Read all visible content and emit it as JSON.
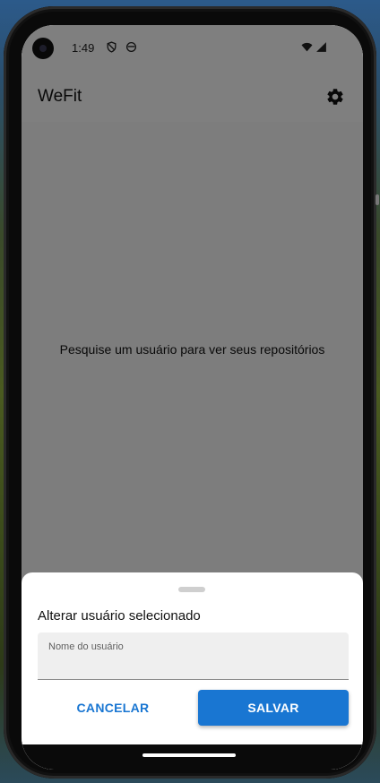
{
  "status_bar": {
    "time": "1:49",
    "icons": [
      "shield-icon",
      "face-icon",
      "wifi-icon",
      "signal-icon"
    ]
  },
  "app_bar": {
    "title": "WeFit",
    "settings_icon": "gear-icon"
  },
  "main": {
    "empty_message": "Pesquise um usuário para ver seus repositórios"
  },
  "bottom_sheet": {
    "title": "Alterar usuário selecionado",
    "username_field": {
      "label": "Nome do usuário",
      "value": "",
      "placeholder": ""
    },
    "cancel_label": "CANCELAR",
    "save_label": "SALVAR"
  },
  "colors": {
    "accent": "#1976d2",
    "scrim": "rgba(0,0,0,0.5)"
  }
}
